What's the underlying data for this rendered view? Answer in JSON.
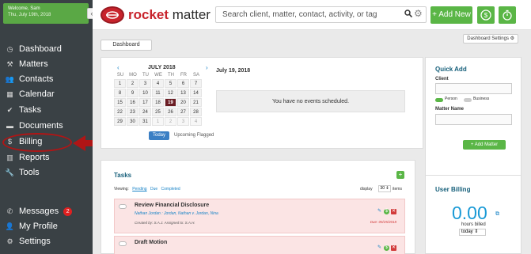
{
  "sidebar": {
    "welcome_line1": "Welcome, Sam",
    "welcome_line2": "Thu, July 19th, 2018",
    "collapse_glyph": "‹",
    "items": [
      {
        "label": "Dashboard",
        "icon": "dashboard-icon",
        "glyph": "◷"
      },
      {
        "label": "Matters",
        "icon": "gavel-icon",
        "glyph": "⚒"
      },
      {
        "label": "Contacts",
        "icon": "contacts-icon",
        "glyph": "👥"
      },
      {
        "label": "Calendar",
        "icon": "calendar-icon",
        "glyph": "▦"
      },
      {
        "label": "Tasks",
        "icon": "check-icon",
        "glyph": "✔"
      },
      {
        "label": "Documents",
        "icon": "folder-icon",
        "glyph": "▬"
      },
      {
        "label": "Billing",
        "icon": "dollar-circle-icon",
        "glyph": "$"
      },
      {
        "label": "Reports",
        "icon": "bar-chart-icon",
        "glyph": "▥"
      },
      {
        "label": "Tools",
        "icon": "wrench-icon",
        "glyph": "🔧"
      }
    ],
    "bottom_items": [
      {
        "label": "Messages",
        "icon": "phone-icon",
        "glyph": "✆",
        "badge": "2"
      },
      {
        "label": "My Profile",
        "icon": "user-icon",
        "glyph": "👤"
      },
      {
        "label": "Settings",
        "icon": "gear-icon",
        "glyph": "⚙"
      }
    ]
  },
  "topbar": {
    "logo_rocket": "rocket",
    "logo_matter": "matter",
    "search_placeholder": "Search client, matter, contact, activity, or tag",
    "add_new_label": "+ Add New"
  },
  "dashboard": {
    "dashboard_button": "Dashboard",
    "settings_button": "Dashboard Settings ⚙"
  },
  "calendar": {
    "month": "JULY 2018",
    "prev": "‹",
    "next": "›",
    "dow": [
      "SU",
      "MO",
      "TU",
      "WE",
      "TH",
      "FR",
      "SA"
    ],
    "days": [
      [
        "1",
        "2",
        "3",
        "4",
        "5",
        "6",
        "7"
      ],
      [
        "8",
        "9",
        "10",
        "11",
        "12",
        "13",
        "14"
      ],
      [
        "15",
        "16",
        "17",
        "18",
        "19",
        "20",
        "21"
      ],
      [
        "22",
        "23",
        "24",
        "25",
        "26",
        "27",
        "28"
      ],
      [
        "29",
        "30",
        "31",
        "1",
        "2",
        "3",
        "4"
      ]
    ],
    "selected_day": "19",
    "today_label": "Today",
    "upcoming_label": "Upcoming Flagged",
    "date_heading": "July 19, 2018",
    "no_events": "You have no events scheduled."
  },
  "quick_add": {
    "title": "Quick Add",
    "client_label": "Client",
    "person_label": "Person",
    "business_label": "Business",
    "matter_label": "Matter Name",
    "add_button": "+ Add Matter"
  },
  "tasks": {
    "title": "Tasks",
    "add_glyph": "+",
    "viewing_label": "Viewing:",
    "filters": [
      "Pending",
      "Due",
      "Completed"
    ],
    "display_label": "display",
    "display_value": "30 ⇕",
    "items_label": "items",
    "rows": [
      {
        "title": "Review Financial Disclosure",
        "matter": "Nathan Jordan : Jordan, Nathan v. Jordan, Nina",
        "meta": "Created by: S.A.J. Assigned to: S.A.H.",
        "due": "Due: 05/25/2018"
      },
      {
        "title": "Draft Motion",
        "matter": "",
        "meta": "",
        "due": ""
      }
    ]
  },
  "user_billing": {
    "title": "User Billing",
    "value": "0.00",
    "hours_label": "hours billed",
    "period": "today ⇕"
  },
  "colors": {
    "sidebar_bg": "#3a4145",
    "accent_green": "#5ab646",
    "brand_red": "#c8232c",
    "link_blue": "#1a84c7",
    "annotation_red": "#b01515"
  }
}
